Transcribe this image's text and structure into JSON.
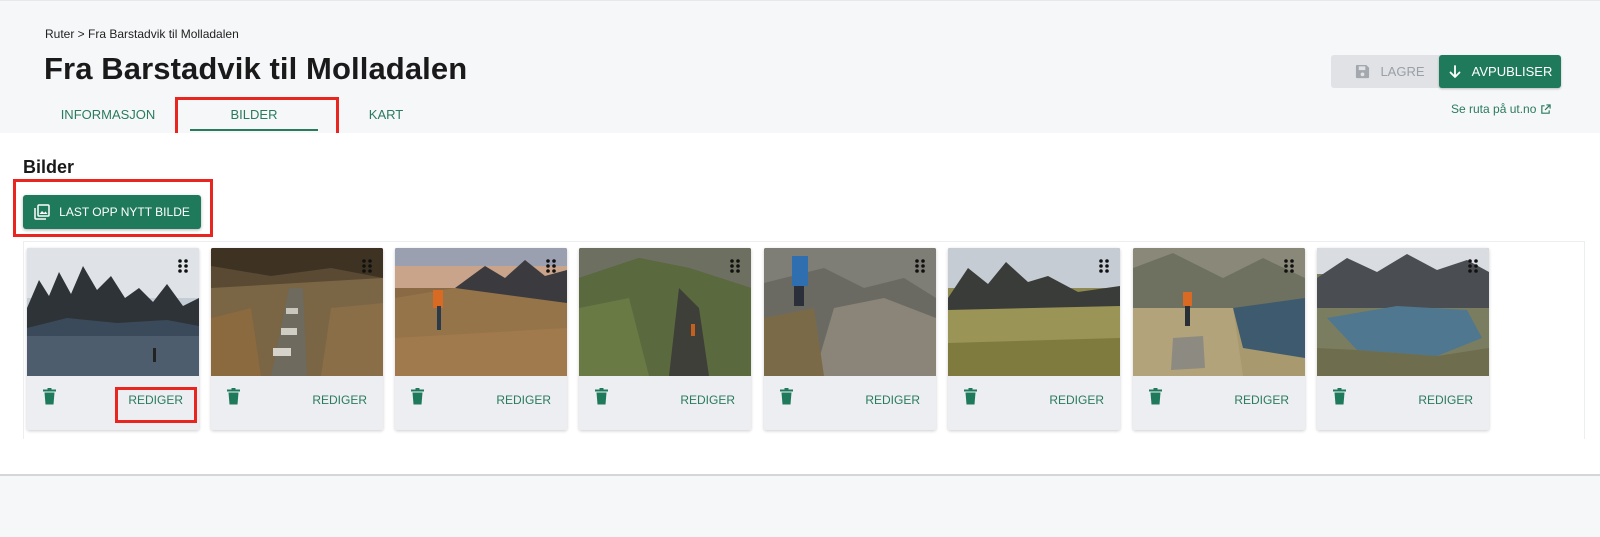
{
  "breadcrumb": "Ruter > Fra Barstadvik til Molladalen",
  "page_title": "Fra Barstadvik til Molladalen",
  "tabs": [
    {
      "label": "INFORMASJON",
      "active": false
    },
    {
      "label": "BILDER",
      "active": true
    },
    {
      "label": "KART",
      "active": false
    }
  ],
  "actions": {
    "save_label": "LAGRE",
    "save_icon": "floppy-disk-icon",
    "save_disabled": true,
    "unpublish_label": "AVPUBLISER",
    "unpublish_icon": "arrow-down-icon",
    "see_route_label": "Se ruta på ut.no",
    "see_route_icon": "external-link-icon"
  },
  "section": {
    "title": "Bilder",
    "upload_label": "LAST OPP NYTT BILDE",
    "upload_icon": "image-upload-icon"
  },
  "images": [
    {
      "edit_label": "REDIGER"
    },
    {
      "edit_label": "REDIGER"
    },
    {
      "edit_label": "REDIGER"
    },
    {
      "edit_label": "REDIGER"
    },
    {
      "edit_label": "REDIGER"
    },
    {
      "edit_label": "REDIGER"
    },
    {
      "edit_label": "REDIGER"
    },
    {
      "edit_label": "REDIGER"
    }
  ],
  "colors": {
    "primary": "#1f7a5c",
    "link": "#2a7a5e",
    "highlight": "#e8261f",
    "disabled_bg": "#e0e2e5"
  }
}
